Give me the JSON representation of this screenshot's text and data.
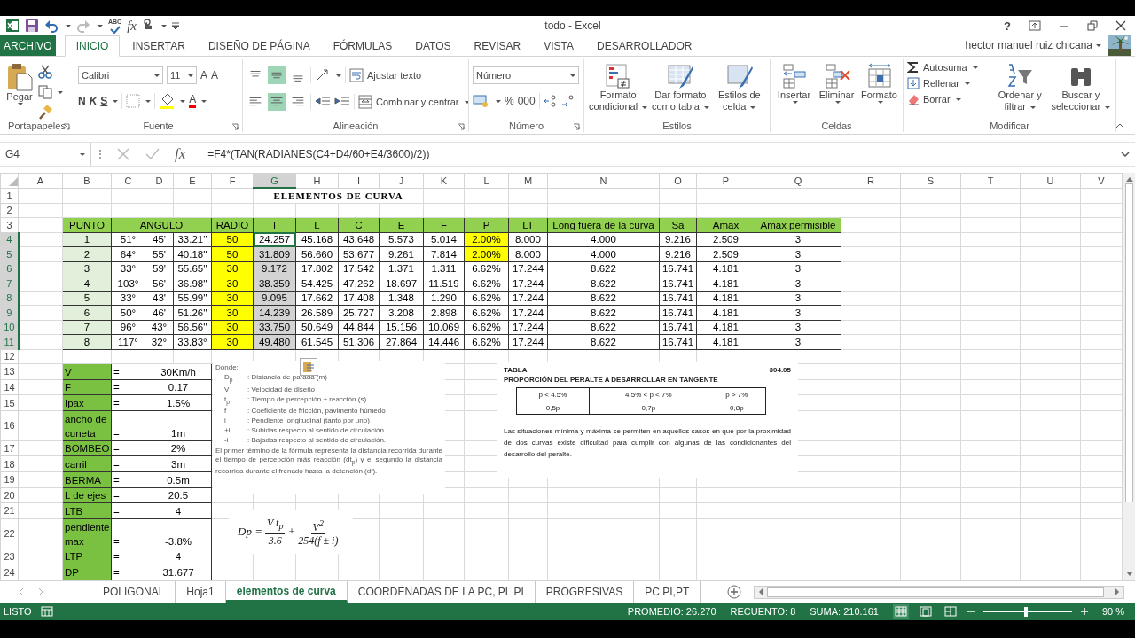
{
  "title_bar": {
    "spelling": "ABC",
    "function": "fx",
    "title": "todo - Excel",
    "help": "?"
  },
  "tabs": [
    {
      "label": "ARCHIVO",
      "kind": "file",
      "selected": false
    },
    {
      "label": "INICIO",
      "kind": "tab",
      "selected": true
    },
    {
      "label": "INSERTAR",
      "kind": "tab",
      "selected": false
    },
    {
      "label": "DISEÑO DE PÁGINA",
      "kind": "tab",
      "selected": false
    },
    {
      "label": "FÓRMULAS",
      "kind": "tab",
      "selected": false
    },
    {
      "label": "DATOS",
      "kind": "tab",
      "selected": false
    },
    {
      "label": "REVISAR",
      "kind": "tab",
      "selected": false
    },
    {
      "label": "VISTA",
      "kind": "tab",
      "selected": false
    },
    {
      "label": "DESARROLLADOR",
      "kind": "tab",
      "selected": false
    }
  ],
  "user": {
    "name": "hector manuel ruiz chicana"
  },
  "ribbon": {
    "clipboard": {
      "paste": "Pegar",
      "label": "Portapapeles"
    },
    "font": {
      "name": "Calibri",
      "size": "11",
      "grow": "A",
      "shrink": "A",
      "bold": "N",
      "italic": "K",
      "underline": "S",
      "font_color_letter": "A",
      "label": "Fuente"
    },
    "alignment": {
      "vertical": [
        {
          "selected": false
        },
        {
          "selected": true
        },
        {
          "selected": false
        }
      ],
      "horizontal": [
        {
          "selected": false
        },
        {
          "selected": true
        },
        {
          "selected": false
        }
      ],
      "wrap": "Ajustar texto",
      "merge": "Combinar y centrar",
      "label": "Alineación"
    },
    "number": {
      "format": "Número",
      "percent": "%",
      "thousands": "000",
      "label": "Número"
    },
    "styles": {
      "buttons": [
        "Formato condicional",
        "Dar formato como tabla",
        "Estilos de celda"
      ],
      "label": "Estilos"
    },
    "cells": {
      "buttons": [
        "Insertar",
        "Eliminar",
        "Formato"
      ],
      "label": "Celdas"
    },
    "editing": {
      "autosum": "Autosuma",
      "fill": "Rellenar",
      "clear": "Borrar",
      "sort": "Ordenar y filtrar",
      "find": "Buscar y seleccionar",
      "label": "Modificar"
    }
  },
  "formula_bar": {
    "name_box": "G4",
    "function": "fx",
    "formula": "=F4*(TAN(RADIANES(C4+D4/60+E4/3600)/2))"
  },
  "sheet": {
    "columns": [
      {
        "label": "A",
        "selected": false
      },
      {
        "label": "B",
        "selected": false
      },
      {
        "label": "C",
        "selected": false
      },
      {
        "label": "D",
        "selected": false
      },
      {
        "label": "E",
        "selected": false
      },
      {
        "label": "F",
        "selected": false
      },
      {
        "label": "G",
        "selected": true
      },
      {
        "label": "H",
        "selected": false
      },
      {
        "label": "I",
        "selected": false
      },
      {
        "label": "J",
        "selected": false
      },
      {
        "label": "K",
        "selected": false
      },
      {
        "label": "L",
        "selected": false
      },
      {
        "label": "M",
        "selected": false
      },
      {
        "label": "N",
        "selected": false
      },
      {
        "label": "O",
        "selected": false
      },
      {
        "label": "P",
        "selected": false
      },
      {
        "label": "Q",
        "selected": false
      },
      {
        "label": "R",
        "selected": false
      },
      {
        "label": "S",
        "selected": false
      },
      {
        "label": "T",
        "selected": false
      },
      {
        "label": "U",
        "selected": false
      },
      {
        "label": "V",
        "selected": false
      }
    ],
    "row_headers": [
      {
        "label": "1",
        "selected": false
      },
      {
        "label": "2",
        "selected": false
      },
      {
        "label": "3",
        "selected": false
      },
      {
        "label": "4",
        "selected": true
      },
      {
        "label": "5",
        "selected": true
      },
      {
        "label": "6",
        "selected": true
      },
      {
        "label": "7",
        "selected": true
      },
      {
        "label": "8",
        "selected": true
      },
      {
        "label": "9",
        "selected": true
      },
      {
        "label": "10",
        "selected": true
      },
      {
        "label": "11",
        "selected": true
      },
      {
        "label": "12",
        "selected": false
      },
      {
        "label": "13",
        "selected": false
      },
      {
        "label": "14",
        "selected": false
      },
      {
        "label": "15",
        "selected": false
      },
      {
        "label": "16",
        "selected": false
      },
      {
        "label": "17",
        "selected": false
      },
      {
        "label": "18",
        "selected": false
      },
      {
        "label": "19",
        "selected": false
      },
      {
        "label": "20",
        "selected": false
      },
      {
        "label": "21",
        "selected": false
      },
      {
        "label": "22",
        "selected": false
      },
      {
        "label": "23",
        "selected": false
      },
      {
        "label": "24",
        "selected": false
      }
    ],
    "title": "ELEMENTOS DE CURVA",
    "curve_table": {
      "headers": [
        "PUNTO",
        "ANGULO",
        "RADIO",
        "T",
        "L",
        "C",
        "E",
        "F",
        "P",
        "LT",
        "Long fuera de la curva",
        "Sa",
        "Amax",
        "Amax permisible"
      ],
      "rows": [
        {
          "values": [
            "1",
            "51°",
            "45'",
            "33.21''",
            "50",
            "24.257",
            "45.168",
            "43.648",
            "5.573",
            "5.014",
            "2.00%",
            "8.000",
            "4.000",
            "9.216",
            "2.509",
            "3"
          ],
          "p_highlight": true,
          "active": true
        },
        {
          "values": [
            "2",
            "64°",
            "55'",
            "40.18''",
            "50",
            "31.809",
            "56.660",
            "53.677",
            "9.261",
            "7.814",
            "2.00%",
            "8.000",
            "4.000",
            "9.216",
            "2.509",
            "3"
          ],
          "p_highlight": true,
          "active": false
        },
        {
          "values": [
            "3",
            "33°",
            "59'",
            "55.65''",
            "30",
            "9.172",
            "17.802",
            "17.542",
            "1.371",
            "1.311",
            "6.62%",
            "17.244",
            "8.622",
            "16.741",
            "4.181",
            "3"
          ],
          "p_highlight": false,
          "active": false
        },
        {
          "values": [
            "4",
            "103°",
            "56'",
            "36.98''",
            "30",
            "38.359",
            "54.425",
            "47.262",
            "18.697",
            "11.519",
            "6.62%",
            "17.244",
            "8.622",
            "16.741",
            "4.181",
            "3"
          ],
          "p_highlight": false,
          "active": false
        },
        {
          "values": [
            "5",
            "33°",
            "43'",
            "55.99''",
            "30",
            "9.095",
            "17.662",
            "17.408",
            "1.348",
            "1.290",
            "6.62%",
            "17.244",
            "8.622",
            "16.741",
            "4.181",
            "3"
          ],
          "p_highlight": false,
          "active": false
        },
        {
          "values": [
            "6",
            "50°",
            "46'",
            "51.26''",
            "30",
            "14.239",
            "26.589",
            "25.727",
            "3.208",
            "2.898",
            "6.62%",
            "17.244",
            "8.622",
            "16.741",
            "4.181",
            "3"
          ],
          "p_highlight": false,
          "active": false
        },
        {
          "values": [
            "7",
            "96°",
            "43°",
            "56.56''",
            "30",
            "33.750",
            "50.649",
            "44.844",
            "15.156",
            "10.069",
            "6.62%",
            "17.244",
            "8.622",
            "16.741",
            "4.181",
            "3"
          ],
          "p_highlight": false,
          "active": false
        },
        {
          "values": [
            "8",
            "117°",
            "32°",
            "33.83°",
            "30",
            "49.480",
            "61.545",
            "51.306",
            "27.864",
            "14.446",
            "6.62%",
            "17.244",
            "8.622",
            "16.741",
            "4.181",
            "3"
          ],
          "p_highlight": false,
          "active": false
        }
      ]
    },
    "parameters": [
      {
        "label": "V",
        "sign": "=",
        "value": "30Km/h"
      },
      {
        "label": "F",
        "sign": "=",
        "value": "0.17"
      },
      {
        "label": "Ipax",
        "sign": "=",
        "value": "1.5%"
      },
      {
        "label": "ancho de cuneta",
        "sign": "=",
        "value": "1m"
      },
      {
        "label": "BOMBEO",
        "sign": "=",
        "value": "2%"
      },
      {
        "label": "carril",
        "sign": "=",
        "value": "3m"
      },
      {
        "label": "BERMA",
        "sign": "=",
        "value": "0.5m"
      },
      {
        "label": "L de ejes",
        "sign": "=",
        "value": "20.5"
      },
      {
        "label": "LTB",
        "sign": "=",
        "value": "4"
      },
      {
        "label": "pendiente max",
        "sign": "=",
        "value": "-3.8%"
      },
      {
        "label": "LTP",
        "sign": "=",
        "value": "4"
      },
      {
        "label": "DP",
        "sign": "=",
        "value": "31.677"
      }
    ]
  },
  "legend_image": {
    "heading": "Dónde:",
    "items": [
      {
        "symbol": "D$_{p}$",
        "text": ": Distancia de parada (m)"
      },
      {
        "symbol": "V",
        "text": ": Velocidad de diseño"
      },
      {
        "symbol": "t$_{p}$",
        "text": ": Tiempo de percepción + reacción (s)"
      },
      {
        "symbol": "f",
        "text": ": Coeficiente de fricción, pavimento húmedo"
      },
      {
        "symbol": "i",
        "text": ": Pendiente longitudinal (tanto por uno)"
      },
      {
        "symbol": "+i",
        "text": ": Subidas respecto al sentido de circulación"
      },
      {
        "symbol": "-i",
        "text": ": Bajadas respecto al sentido de circulación."
      }
    ],
    "note": "El primer término de la fórmula representa la distancia recorrida durante el tiempo de percepción más reacción (dt$_{p}$) y el segundo la distancia recorrida durante el frenado hasta la detención (df)."
  },
  "formula_image": {
    "lhs": "Dp =",
    "num1": "V t$_{p}$",
    "den1": "3.6",
    "plus": "+",
    "num2": "V$^{2}$",
    "den2": "254(f ± i)"
  },
  "table_image": {
    "caption": "TABLA",
    "number": "304.05",
    "title": "PROPORCIÓN DEL PERALTE A DESARROLLAR EN TANGENTE",
    "header": [
      "p < 4.5%",
      "4.5% < p < 7%",
      "p > 7%"
    ],
    "values": [
      "0,5p",
      "0,7p",
      "0,8p"
    ],
    "note": "Las situaciones mínima y máxima se permiten en aquellos casos en que por la proximidad de dos curvas existe dificultad para cumplir con algunas de las condicionantes del desarrollo del peralte."
  },
  "sheet_tabs": [
    {
      "label": "POLIGONAL",
      "selected": false
    },
    {
      "label": "Hoja1",
      "selected": false
    },
    {
      "label": "elementos de curva",
      "selected": true
    },
    {
      "label": "COORDENADAS DE LA PC, PL PI",
      "selected": false
    },
    {
      "label": "PROGRESIVAS",
      "selected": false
    },
    {
      "label": "PC,PI,PT",
      "selected": false
    }
  ],
  "status_bar": {
    "mode": "LISTO",
    "average": "PROMEDIO: 26.270",
    "count": "RECUENTO: 8",
    "sum": "SUMA: 210.161",
    "views": [
      {
        "kind": "normal",
        "selected": true
      },
      {
        "kind": "page",
        "selected": false
      },
      {
        "kind": "preview",
        "selected": false
      }
    ],
    "zoom": {
      "level": 0.48,
      "reading": "90 %"
    }
  }
}
